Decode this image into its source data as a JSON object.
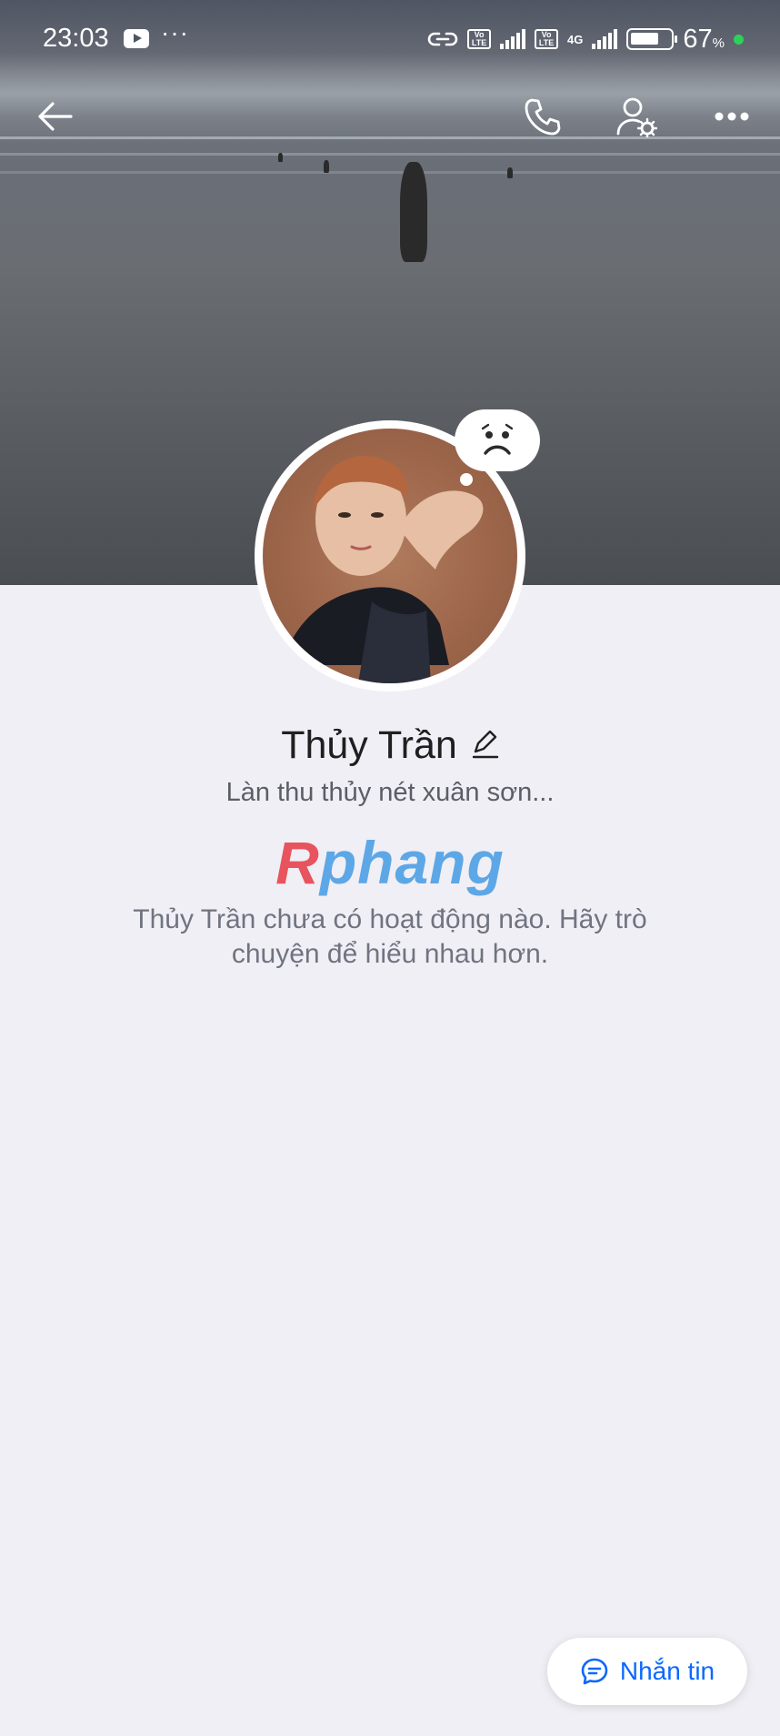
{
  "status_bar": {
    "time": "23:03",
    "network_labels": [
      "Vo LTE",
      "Vo LTE"
    ],
    "network_type": "4G",
    "battery_percent": "67",
    "battery_unit": "%"
  },
  "topbar": {
    "back_icon": "arrow-left-icon",
    "call_icon": "phone-icon",
    "settings_icon": "user-settings-icon",
    "more_icon": "more-dots-icon"
  },
  "profile": {
    "name": "Thủy Trần",
    "status_text": "Làn thu thủy nét xuân sơn...",
    "mood_icon": "sad-face-icon",
    "edit_icon": "pencil-icon"
  },
  "watermark": {
    "part1": "R",
    "part2": "phang"
  },
  "feed": {
    "empty_message": "Thủy Trần chưa có hoạt động nào. Hãy trò chuyện để hiểu nhau hơn."
  },
  "actions": {
    "message_label": "Nhắn tin",
    "message_icon": "chat-bubble-icon"
  },
  "colors": {
    "accent": "#0a68ff",
    "background": "#f0eff5"
  }
}
